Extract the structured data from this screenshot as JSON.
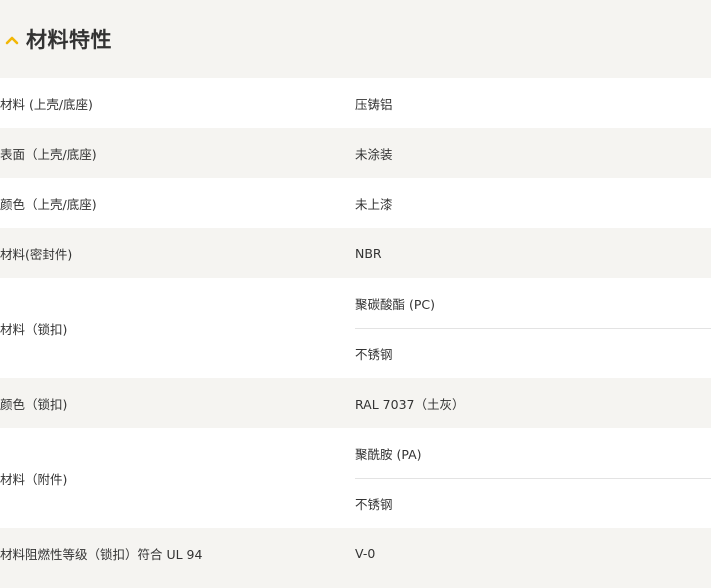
{
  "section": {
    "title": "材料特性",
    "accent_color": "#f2b705",
    "toggle_icon": "chevron-up-icon"
  },
  "rows": [
    {
      "label": "材料 (上壳/底座)",
      "values": [
        "压铸铝"
      ]
    },
    {
      "label": "表面（上壳/底座)",
      "values": [
        "未涂装"
      ]
    },
    {
      "label": "颜色（上壳/底座)",
      "values": [
        "未上漆"
      ]
    },
    {
      "label": "材料(密封件)",
      "values": [
        "NBR"
      ]
    },
    {
      "label": "材料（锁扣)",
      "values": [
        "聚碳酸酯 (PC)",
        "不锈钢"
      ]
    },
    {
      "label": "颜色（锁扣)",
      "values": [
        "RAL 7037（土灰）"
      ]
    },
    {
      "label": "材料（附件)",
      "values": [
        "聚酰胺 (PA)",
        "不锈钢"
      ]
    },
    {
      "label": "材料阻燃性等级（锁扣）符合 UL 94",
      "values": [
        "V-0"
      ]
    }
  ]
}
